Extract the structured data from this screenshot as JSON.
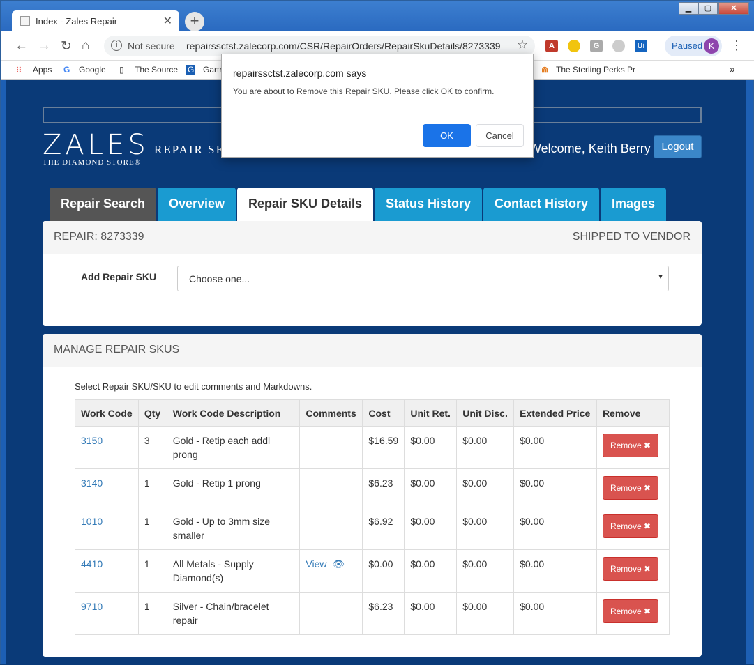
{
  "browser": {
    "tab_title": "Index - Zales Repair",
    "not_secure": "Not secure",
    "url": "repairssctst.zalecorp.com/CSR/RepairOrders/RepairSkuDetails/8273339",
    "profile_status": "Paused",
    "profile_initial": "K",
    "bookmarks": [
      "Apps",
      "Google",
      "The Source",
      "Gartr",
      "The Sterling Perks Pr"
    ]
  },
  "dialog": {
    "title": "repairssctst.zalecorp.com says",
    "message": "You are about to Remove this Repair SKU.  Please click OK to confirm.",
    "ok_label": "OK",
    "cancel_label": "Cancel"
  },
  "header": {
    "logo_text": "ZALES",
    "logo_sub": "THE DIAMOND STORE®",
    "app_name": "REPAIR SERVICES",
    "welcome": "Welcome, Keith Berry",
    "logout_label": "Logout"
  },
  "tabs": [
    {
      "label": "Repair Search",
      "color": "#555555"
    },
    {
      "label": "Overview",
      "color": "#1a9bd1"
    },
    {
      "label": "Repair SKU Details",
      "color": "#ffffff"
    },
    {
      "label": "Status History",
      "color": "#1a9bd1"
    },
    {
      "label": "Contact History",
      "color": "#1a9bd1"
    },
    {
      "label": "Images",
      "color": "#1a9bd1"
    }
  ],
  "repair": {
    "title": "REPAIR: 8273339",
    "status": "SHIPPED TO VENDOR",
    "add_sku_label": "Add Repair SKU",
    "select_value": "Choose one..."
  },
  "manage": {
    "title": "MANAGE REPAIR SKUS",
    "hint": "Select Repair SKU/SKU to edit comments and Markdowns.",
    "columns": [
      "Work Code",
      "Qty",
      "Work Code Description",
      "Comments",
      "Cost",
      "Unit Ret.",
      "Unit Disc.",
      "Extended Price",
      "Remove"
    ],
    "rows": [
      {
        "code": "3150",
        "qty": "3",
        "desc": "Gold - Retip each addl prong",
        "comments": "",
        "cost": "$16.59",
        "unit_ret": "$0.00",
        "unit_disc": "$0.00",
        "ext": "$0.00",
        "remove": "Remove"
      },
      {
        "code": "3140",
        "qty": "1",
        "desc": "Gold - Retip 1 prong",
        "comments": "",
        "cost": "$6.23",
        "unit_ret": "$0.00",
        "unit_disc": "$0.00",
        "ext": "$0.00",
        "remove": "Remove"
      },
      {
        "code": "1010",
        "qty": "1",
        "desc": "Gold - Up to 3mm size smaller",
        "comments": "",
        "cost": "$6.92",
        "unit_ret": "$0.00",
        "unit_disc": "$0.00",
        "ext": "$0.00",
        "remove": "Remove"
      },
      {
        "code": "4410",
        "qty": "1",
        "desc": "All Metals - Supply Diamond(s)",
        "comments": "View",
        "cost": "$0.00",
        "unit_ret": "$0.00",
        "unit_disc": "$0.00",
        "ext": "$0.00",
        "remove": "Remove"
      },
      {
        "code": "9710",
        "qty": "1",
        "desc": "Silver - Chain/bracelet repair",
        "comments": "",
        "cost": "$6.23",
        "unit_ret": "$0.00",
        "unit_disc": "$0.00",
        "ext": "$0.00",
        "remove": "Remove"
      }
    ]
  }
}
